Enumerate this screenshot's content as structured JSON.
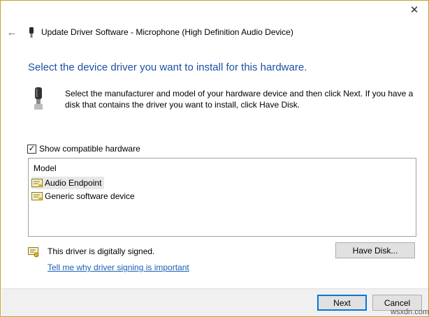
{
  "window": {
    "title": "Update Driver Software - Microphone (High Definition Audio Device)",
    "close_glyph": "✕",
    "back_glyph": "←"
  },
  "main": {
    "heading": "Select the device driver you want to install for this hardware.",
    "instruction": "Select the manufacturer and model of your hardware device and then click Next. If you have a disk that contains the driver you want to install, click Have Disk.",
    "show_compatible": {
      "label": "Show compatible hardware",
      "checked": true,
      "check_glyph": "✓"
    },
    "list": {
      "header": "Model",
      "items": [
        {
          "label": "Audio Endpoint",
          "selected": true
        },
        {
          "label": "Generic software device",
          "selected": false
        }
      ]
    },
    "signing": {
      "status": "This driver is digitally signed.",
      "link": "Tell me why driver signing is important"
    },
    "have_disk_label": "Have Disk..."
  },
  "footer": {
    "next_label": "Next",
    "cancel_label": "Cancel",
    "watermark": "wsxdn.com"
  },
  "colors": {
    "heading": "#1e4fa2",
    "link": "#1a5fb4",
    "default_button_border": "#0078d7",
    "window_border": "#c9a227"
  },
  "icons": {
    "title_icon": "microphone-icon",
    "header_icon": "microphone-icon",
    "list_item_icon": "driver-certificate-icon",
    "signed_icon": "signed-certificate-icon"
  }
}
